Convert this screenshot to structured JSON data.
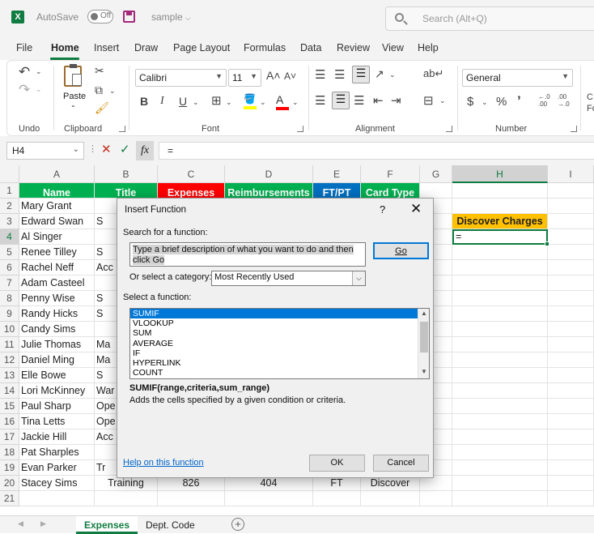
{
  "titlebar": {
    "logo": "X",
    "autosave_label": "AutoSave",
    "autosave_state": "Off",
    "doc_name": "sample",
    "search_placeholder": "Search (Alt+Q)"
  },
  "menu": [
    "File",
    "Home",
    "Insert",
    "Draw",
    "Page Layout",
    "Formulas",
    "Data",
    "Review",
    "View",
    "Help"
  ],
  "ribbon": {
    "groups": [
      "Undo",
      "Clipboard",
      "Font",
      "Alignment",
      "Number"
    ],
    "paste_label": "Paste",
    "font_name": "Calibri",
    "font_size": "11",
    "number_format": "General",
    "grow_font": "A˄",
    "shrink_font": "A˅",
    "bold": "B",
    "italic": "I",
    "underline": "U",
    "currency": "$",
    "percent": "%",
    "comma": "’",
    "inc_decimal": "←.0\n.00",
    "dec_decimal": ".00\n→.0",
    "cut_partial": "C\nFo"
  },
  "formula_bar": {
    "name_box": "H4",
    "formula": "=",
    "fx": "fx"
  },
  "columns": [
    "A",
    "B",
    "C",
    "D",
    "E",
    "F",
    "G",
    "H",
    "I"
  ],
  "rows": [
    "1",
    "2",
    "3",
    "4",
    "5",
    "6",
    "7",
    "8",
    "9",
    "10",
    "11",
    "12",
    "13",
    "14",
    "15",
    "16",
    "17",
    "18",
    "19",
    "20",
    "21"
  ],
  "header_row": [
    "Name",
    "Title",
    "Expenses",
    "Reimbursements",
    "FT/PT",
    "Card Type"
  ],
  "names": [
    "Mary Grant",
    "Edward Swan",
    "Al Singer",
    "Renee Tilley",
    "Rachel Neff",
    "Adam Casteel",
    "Penny Wise",
    "Randy Hicks",
    "Candy Sims",
    "Julie Thomas",
    "Daniel Ming",
    "Elle Bowe",
    "Lori McKinney",
    "Paul Sharp",
    "Tina Letts",
    "Jackie Hill",
    "Pat Sharples",
    "Evan Parker",
    "Stacey Sims"
  ],
  "titles_partial": [
    "",
    "S",
    "",
    "S",
    "Acc",
    "",
    "S",
    "S",
    "",
    "Ma",
    "Ma",
    "S",
    "War",
    "Ope",
    "Ope",
    "Acc",
    "",
    "Tr",
    "Training"
  ],
  "row20": {
    "expenses": "826",
    "reimbursements": "404",
    "ftpt": "FT",
    "card": "Discover"
  },
  "discover_label": "Discover Charges",
  "active_cell_value": "=",
  "colors": {
    "green": "#00b050",
    "red": "#ff0000",
    "blue": "#0070c0",
    "yellow": "#ffc000",
    "excel": "#107c41"
  },
  "sheets": [
    "Expenses",
    "Dept. Code"
  ],
  "dialog": {
    "title": "Insert Function",
    "help": "?",
    "close": "✕",
    "search_label": "Search for a function:",
    "search_value": "Type a brief description of what you want to do and then click Go",
    "go_button": "Go",
    "category_label": "Or select a category:",
    "category_value": "Most Recently Used",
    "select_label": "Select a function:",
    "functions": [
      "SUMIF",
      "VLOOKUP",
      "SUM",
      "AVERAGE",
      "IF",
      "HYPERLINK",
      "COUNT"
    ],
    "selected_function": "SUMIF",
    "syntax": "SUMIF(range,criteria,sum_range)",
    "description": "Adds the cells specified by a given condition or criteria.",
    "help_link": "Help on this function",
    "ok": "OK",
    "cancel": "Cancel"
  }
}
